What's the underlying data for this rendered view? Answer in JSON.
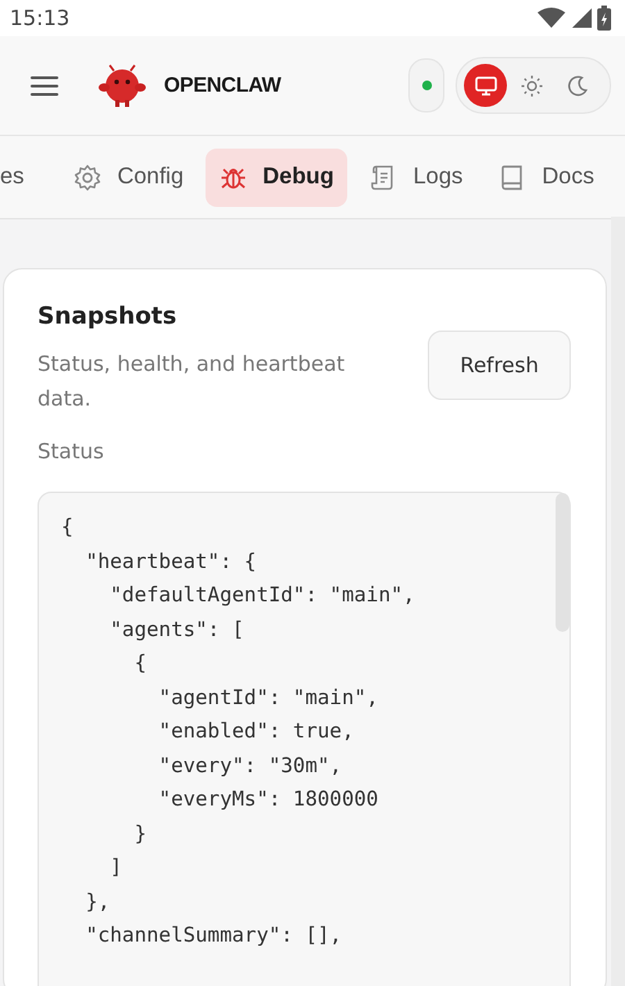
{
  "status_bar": {
    "time": "15:13"
  },
  "header": {
    "brand": "OPENCLAW",
    "connected": true,
    "theme_options": [
      {
        "kind": "system",
        "selected": true
      },
      {
        "kind": "light",
        "selected": false
      },
      {
        "kind": "dark",
        "selected": false
      }
    ]
  },
  "tabs": [
    {
      "label": "es",
      "kind": "none",
      "selected": false
    },
    {
      "label": "Config",
      "kind": "gear",
      "selected": false
    },
    {
      "label": "Debug",
      "kind": "bug",
      "selected": true
    },
    {
      "label": "Logs",
      "kind": "scroll",
      "selected": false
    },
    {
      "label": "Docs",
      "kind": "book",
      "selected": false
    }
  ],
  "card": {
    "title": "Snapshots",
    "subtitle": "Status, health, and heartbeat data.",
    "button": "Refresh",
    "section_label": "Status",
    "code_lines": [
      "{",
      "  \"heartbeat\": {",
      "    \"defaultAgentId\": \"main\",",
      "    \"agents\": [",
      "      {",
      "        \"agentId\": \"main\",",
      "        \"enabled\": true,",
      "        \"every\": \"30m\",",
      "        \"everyMs\": 1800000",
      "      }",
      "    ]",
      "  },",
      "  \"channelSummary\": [],"
    ]
  }
}
